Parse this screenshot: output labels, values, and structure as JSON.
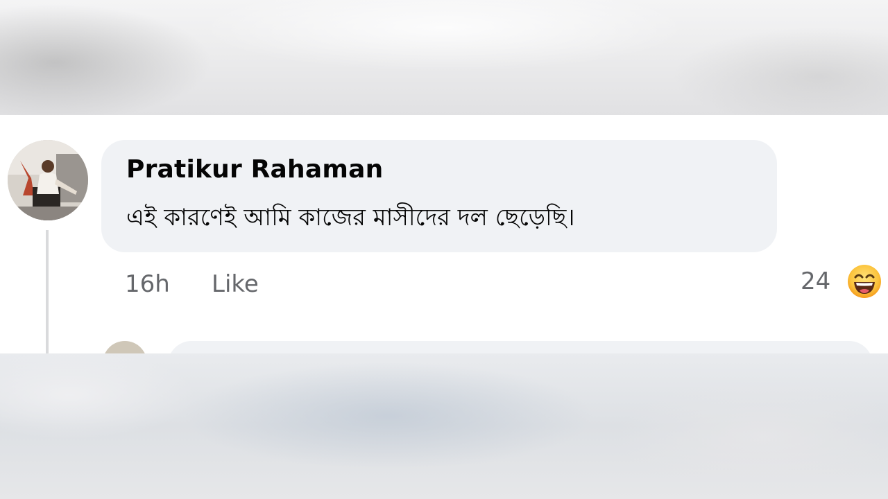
{
  "comment": {
    "author": "Pratikur Rahaman",
    "text": "এই কারণেই আমি কাজের মাসীদের দল ছেড়েছি।",
    "time": "16h",
    "like_label": "Like",
    "reaction_count": "24",
    "reaction_icon": "laughing-emoji-icon"
  },
  "colors": {
    "bubble": "#f0f2f5",
    "meta_text": "#65676b",
    "primary_text": "#050505"
  }
}
